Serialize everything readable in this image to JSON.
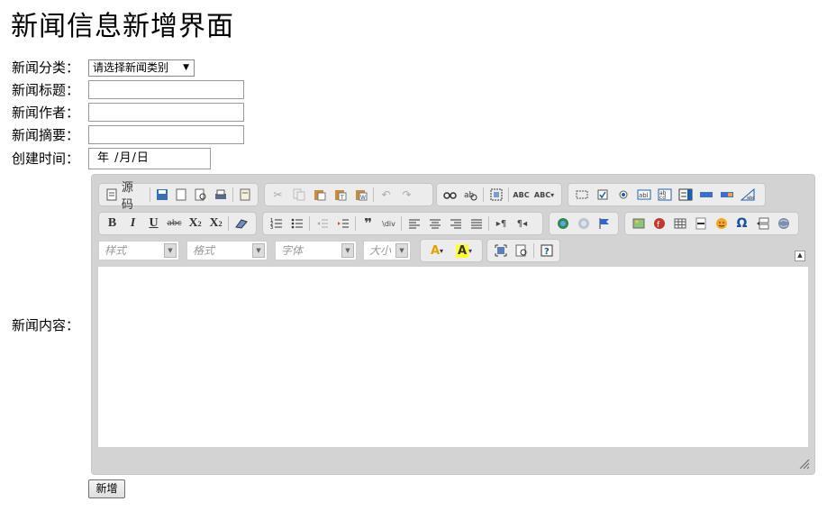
{
  "page_title": "新闻信息新增界面",
  "form": {
    "category_label": "新闻分类：",
    "category_selected": "请选择新闻类别",
    "title_label": "新闻标题：",
    "title_value": "",
    "author_label": "新闻作者：",
    "author_value": "",
    "summary_label": "新闻摘要：",
    "summary_value": "",
    "created_label": "创建时间：",
    "created_value": "年 /月/日",
    "content_label": "新闻内容：",
    "submit_label": "新增"
  },
  "editor": {
    "source_label": "源码",
    "style_combo": "样式",
    "format_combo": "格式",
    "font_combo": "字体",
    "size_combo": "大小",
    "toolbar_row1": [
      "document-icon",
      "save-icon",
      "newpage-icon",
      "preview-icon",
      "print-icon",
      "templates-icon",
      "cut-icon",
      "copy-icon",
      "paste-icon",
      "paste-text-icon",
      "paste-word-icon",
      "undo-icon",
      "redo-icon",
      "find-icon",
      "replace-icon",
      "select-all-icon",
      "spellcheck-icon",
      "scayt-icon",
      "form-icon",
      "checkbox-icon",
      "radio-icon",
      "textfield-icon",
      "textarea-icon",
      "select-icon",
      "button-icon",
      "imagebutton-icon",
      "hiddenfield-icon"
    ],
    "toolbar_row2": [
      "bold-icon",
      "italic-icon",
      "underline-icon",
      "strike-icon",
      "subscript-icon",
      "superscript-icon",
      "remove-format-icon",
      "numbered-list-icon",
      "bulleted-list-icon",
      "outdent-icon",
      "indent-icon",
      "blockquote-icon",
      "div-icon",
      "align-left-icon",
      "align-center-icon",
      "align-right-icon",
      "justify-icon",
      "ltr-icon",
      "rtl-icon",
      "link-icon",
      "unlink-icon",
      "anchor-icon",
      "image-icon",
      "flash-icon",
      "table-icon",
      "hr-icon",
      "smiley-icon",
      "special-char-icon",
      "pagebreak-icon",
      "iframe-icon"
    ],
    "toolbar_row3": [
      "text-color-icon",
      "bg-color-icon",
      "maximize-icon",
      "show-blocks-icon",
      "about-icon"
    ]
  }
}
